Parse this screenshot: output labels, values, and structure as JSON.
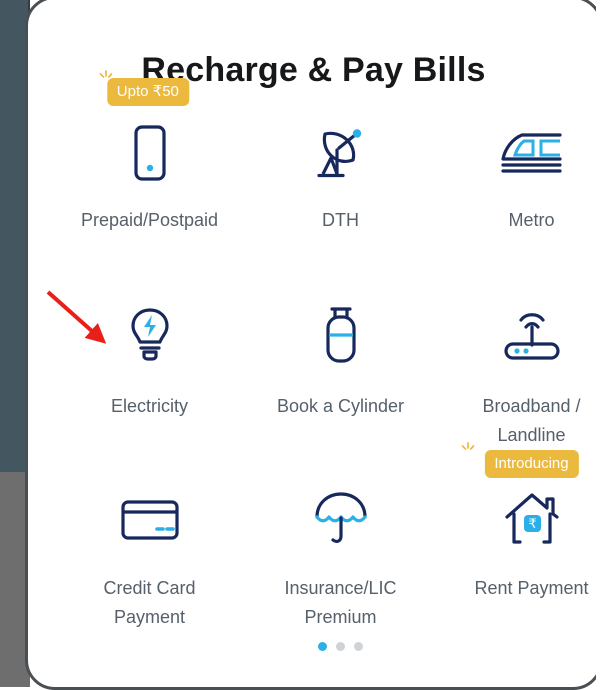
{
  "header": {
    "title": "Recharge & Pay Bills"
  },
  "colors": {
    "icon_primary": "#16285c",
    "icon_accent": "#2ab0e6",
    "badge_bg": "#ecb93f",
    "badge_text": "#ffffff",
    "label_text": "#56606b",
    "title_text": "#17181a",
    "dot_active": "#2ab0e6",
    "dot_inactive": "#cfd3d6",
    "annotation_arrow": "#e8201a",
    "chrome_top": "#445761",
    "chrome_bottom": "#6e6e6e"
  },
  "grid": {
    "tiles": [
      {
        "id": "prepaid-postpaid",
        "label": "Prepaid/Postpaid",
        "icon": "mobile-phone-icon",
        "badge": "Upto ₹50"
      },
      {
        "id": "dth",
        "label": "DTH",
        "icon": "satellite-dish-icon",
        "badge": ""
      },
      {
        "id": "metro",
        "label": "Metro",
        "icon": "metro-train-icon",
        "badge": ""
      },
      {
        "id": "electricity",
        "label": "Electricity",
        "icon": "light-bulb-icon",
        "badge": ""
      },
      {
        "id": "book-a-cylinder",
        "label": "Book a Cylinder",
        "icon": "gas-cylinder-icon",
        "badge": ""
      },
      {
        "id": "broadband-landline",
        "label": "Broadband /\nLandline",
        "icon": "wifi-router-icon",
        "badge": ""
      },
      {
        "id": "credit-card-payment",
        "label": "Credit Card\nPayment",
        "icon": "credit-card-icon",
        "badge": ""
      },
      {
        "id": "insurance-lic-premium",
        "label": "Insurance/LIC\nPremium",
        "icon": "umbrella-icon",
        "badge": ""
      },
      {
        "id": "rent-payment",
        "label": "Rent Payment",
        "icon": "house-rupee-icon",
        "badge": "Introducing"
      }
    ]
  },
  "pager": {
    "total": 3,
    "active_index": 0
  },
  "annotation": {
    "type": "arrow",
    "points_to": "electricity"
  }
}
